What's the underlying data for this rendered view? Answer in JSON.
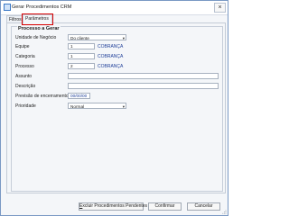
{
  "window": {
    "title": "Gerar Procedimentos CRM",
    "close_glyph": "×"
  },
  "tabs": [
    {
      "label": "Filtros",
      "active": false
    },
    {
      "label": "Parâmetros",
      "active": true
    }
  ],
  "group": {
    "title": "Processo a Gerar"
  },
  "fields": {
    "unidade": {
      "label": "Unidade de Negócio",
      "value": "Do cliente"
    },
    "equipe": {
      "label": "Equipe",
      "value": "1",
      "link": "COBRANÇA"
    },
    "categoria": {
      "label": "Categoria",
      "value": "1",
      "link": "COBRANÇA"
    },
    "processo": {
      "label": "Processo",
      "value": "2",
      "link": "COBRANÇA"
    },
    "assunto": {
      "label": "Assunto",
      "value": ""
    },
    "descricao": {
      "label": "Descrição",
      "value": ""
    },
    "previsao": {
      "label": "Previsão de encerramento",
      "value": "00/00/00"
    },
    "prioridade": {
      "label": "Prioridade",
      "value": "Normal"
    }
  },
  "buttons": {
    "excluir": {
      "accel": "E",
      "rest": "xcluir Procedimentos Pendentes"
    },
    "confirmar": "Confirmar",
    "cancelar": "Cancelar"
  },
  "colors": {
    "accent_link": "#1f3f99",
    "tab_highlight": "#d80000"
  },
  "icons": [
    "app-icon",
    "close-icon",
    "chevron-down-icon",
    "resize-grip-icon"
  ]
}
